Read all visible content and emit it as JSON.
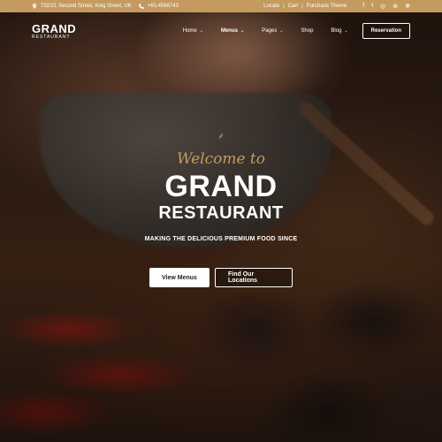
{
  "topbar": {
    "address": "732/21 Second Street, King Street, UK",
    "phone": "+65.4566743",
    "links": [
      "Locate",
      "Cart",
      "Purchase Theme"
    ],
    "social_icons": [
      "facebook-icon",
      "twitter-icon",
      "instagram-icon",
      "foursquare-icon",
      "yelp-icon"
    ]
  },
  "header": {
    "logo_main": "GRAND",
    "logo_sub": "RESTAURANT",
    "nav": [
      "Home",
      "Menus",
      "Pages",
      "Shop",
      "Blog"
    ],
    "active_nav": "Menus",
    "reservation": "Reservation"
  },
  "hero": {
    "welcome": "Welcome to",
    "title": "GRAND",
    "subtitle": "RESTAURANT",
    "tagline": "MAKING THE DELICIOUS PREMIUM FOOD SINCE"
  },
  "buttons": {
    "primary": "View Menus",
    "secondary": "Find Our Locations"
  },
  "colors": {
    "accent": "#c49a5e",
    "topbar_bg": "#c49a5e"
  }
}
